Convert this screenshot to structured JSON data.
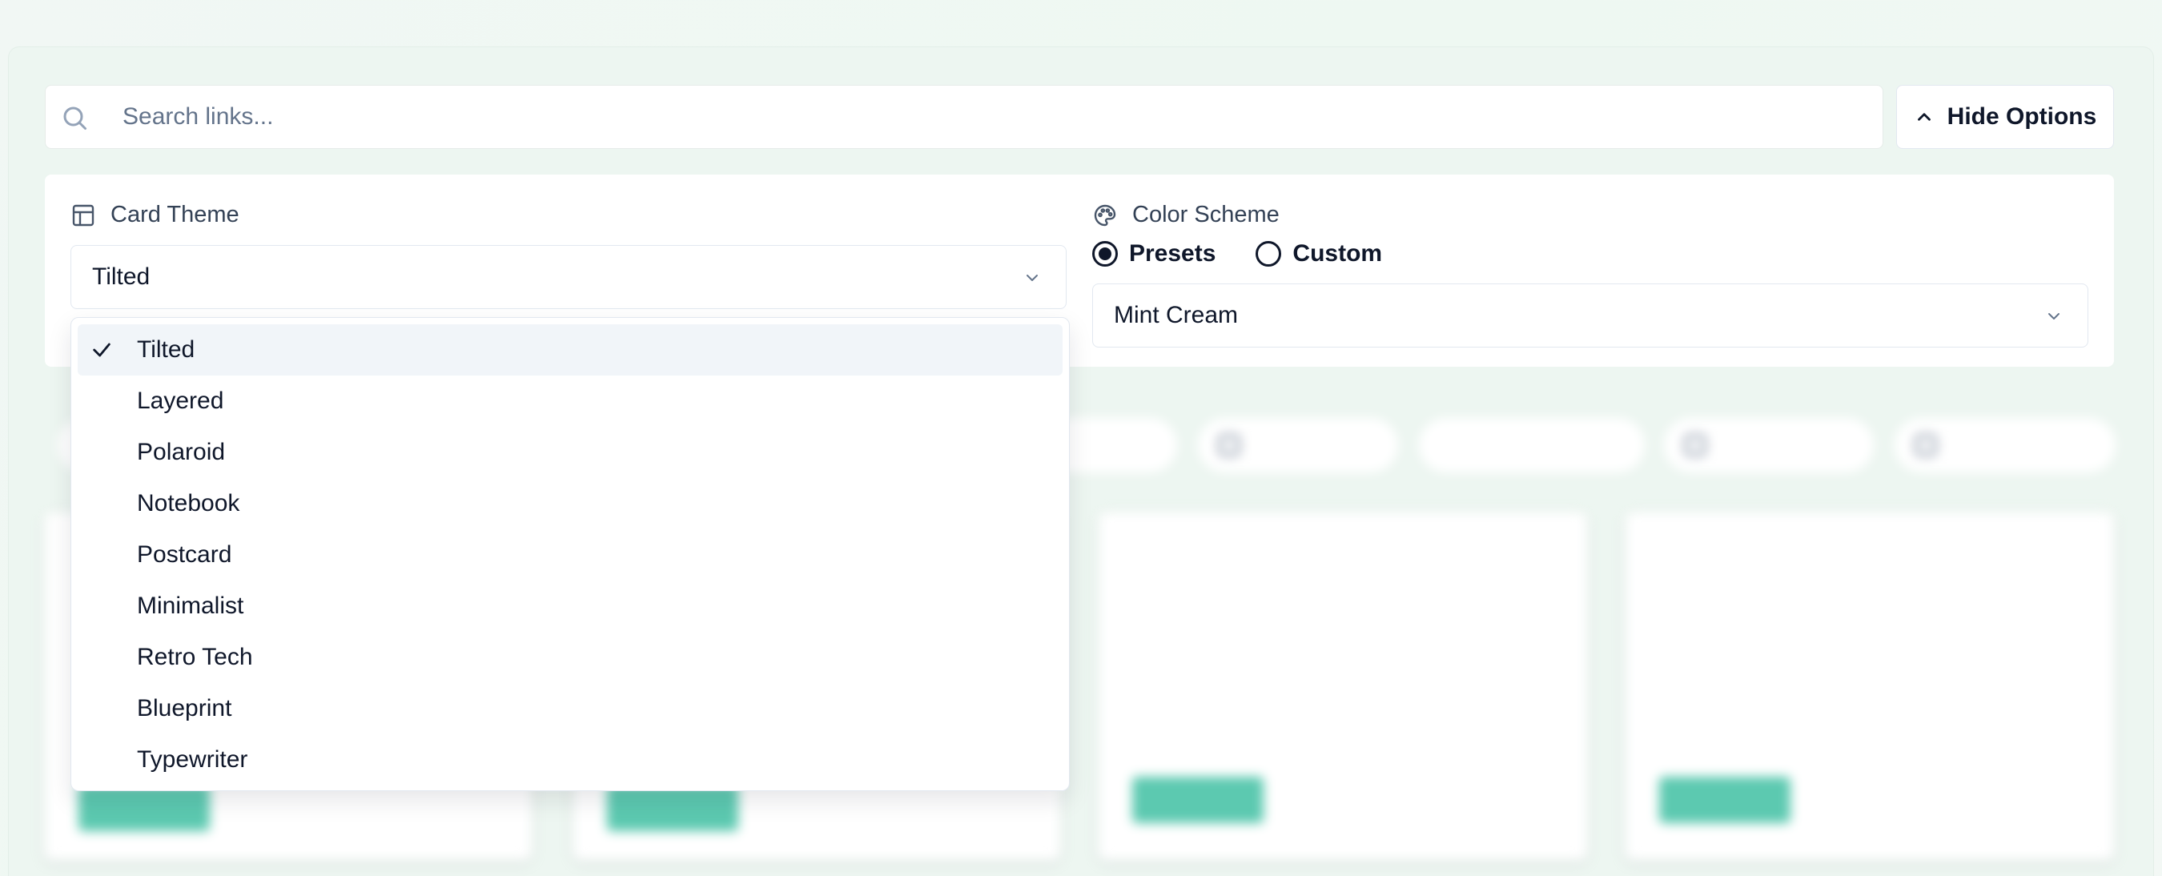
{
  "search": {
    "placeholder": "Search links...",
    "value": ""
  },
  "toolbar": {
    "hide_options_label": "Hide Options"
  },
  "options": {
    "card_theme": {
      "label": "Card Theme",
      "selected": "Tilted",
      "items": [
        "Tilted",
        "Layered",
        "Polaroid",
        "Notebook",
        "Postcard",
        "Minimalist",
        "Retro Tech",
        "Blueprint",
        "Typewriter"
      ]
    },
    "color_scheme": {
      "label": "Color Scheme",
      "radio_presets": "Presets",
      "radio_custom": "Custom",
      "selected_mode": "Presets",
      "selected_preset": "Mint Cream"
    }
  },
  "colors": {
    "accent_tag": "#5cc9b0",
    "background": "#eef7f2",
    "text": "#0f172a"
  }
}
